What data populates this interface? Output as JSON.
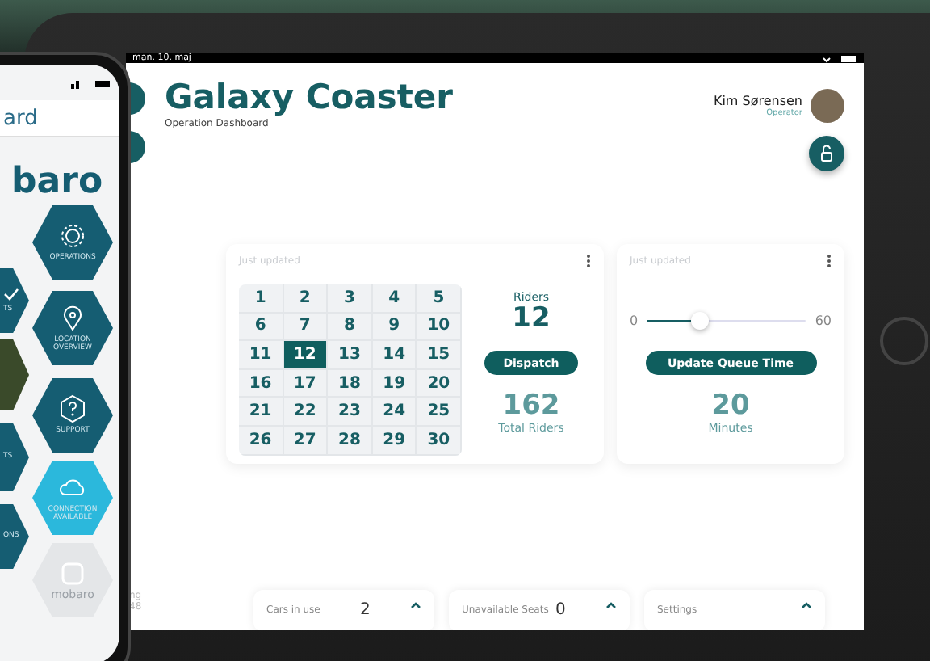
{
  "tablet": {
    "status_bar": {
      "date": "man. 10. maj"
    },
    "header": {
      "title": "Galaxy Coaster",
      "subtitle": "Operation Dashboard",
      "user": {
        "name": "Kim Sørensen",
        "role": "Operator"
      }
    },
    "sidebar_fragments": [
      "ng",
      "48"
    ],
    "riders_card": {
      "status": "Just updated",
      "calendar": [
        {
          "label": "1",
          "selected": false
        },
        {
          "label": "2",
          "selected": false
        },
        {
          "label": "3",
          "selected": false
        },
        {
          "label": "4",
          "selected": false
        },
        {
          "label": "5",
          "selected": false
        },
        {
          "label": "6",
          "selected": false
        },
        {
          "label": "7",
          "selected": false
        },
        {
          "label": "8",
          "selected": false
        },
        {
          "label": "9",
          "selected": false
        },
        {
          "label": "10",
          "selected": false
        },
        {
          "label": "11",
          "selected": false
        },
        {
          "label": "12",
          "selected": true
        },
        {
          "label": "13",
          "selected": false
        },
        {
          "label": "14",
          "selected": false
        },
        {
          "label": "15",
          "selected": false
        },
        {
          "label": "16",
          "selected": false
        },
        {
          "label": "17",
          "selected": false
        },
        {
          "label": "18",
          "selected": false
        },
        {
          "label": "19",
          "selected": false
        },
        {
          "label": "20",
          "selected": false
        },
        {
          "label": "21",
          "selected": false
        },
        {
          "label": "22",
          "selected": false
        },
        {
          "label": "23",
          "selected": false
        },
        {
          "label": "24",
          "selected": false
        },
        {
          "label": "25",
          "selected": false
        },
        {
          "label": "26",
          "selected": false
        },
        {
          "label": "27",
          "selected": false
        },
        {
          "label": "28",
          "selected": false
        },
        {
          "label": "29",
          "selected": false
        },
        {
          "label": "30",
          "selected": false
        }
      ],
      "riders_label": "Riders",
      "riders_count": "12",
      "dispatch_button": "Dispatch",
      "total": "162",
      "total_label": "Total Riders"
    },
    "queue_card": {
      "status": "Just updated",
      "slider": {
        "min": "0",
        "max": "60",
        "level": 0.33
      },
      "button": "Update Queue Time",
      "value": "20",
      "unit": "Minutes"
    },
    "bottom_bars": [
      {
        "label": "Cars in use",
        "value": "2"
      },
      {
        "label": "Unavailable Seats",
        "value": "0"
      },
      {
        "label": "Settings"
      }
    ]
  },
  "phone": {
    "title": "ard",
    "logo": "baro",
    "tiles": [
      {
        "label": "OPERATIONS",
        "kind": "gear",
        "color": "#155d72"
      },
      {
        "label": "TS",
        "kind": "check",
        "color": "#155d72"
      },
      {
        "label": "LOCATION OVERVIEW",
        "kind": "pin",
        "color": "#155d72"
      },
      {
        "kind": "photo",
        "color": "#3a4a2a"
      },
      {
        "label": "SUPPORT",
        "kind": "question",
        "color": "#155d72"
      },
      {
        "label": "TS",
        "kind": "plain",
        "color": "#155d72"
      },
      {
        "label": "CONNECTION AVAILABLE",
        "kind": "cloud",
        "color": "#2bb8dc"
      },
      {
        "label": "ONS",
        "kind": "plain",
        "color": "#155d72"
      },
      {
        "label": "mobaro",
        "kind": "logo",
        "color": "#e4e6e8"
      }
    ]
  }
}
